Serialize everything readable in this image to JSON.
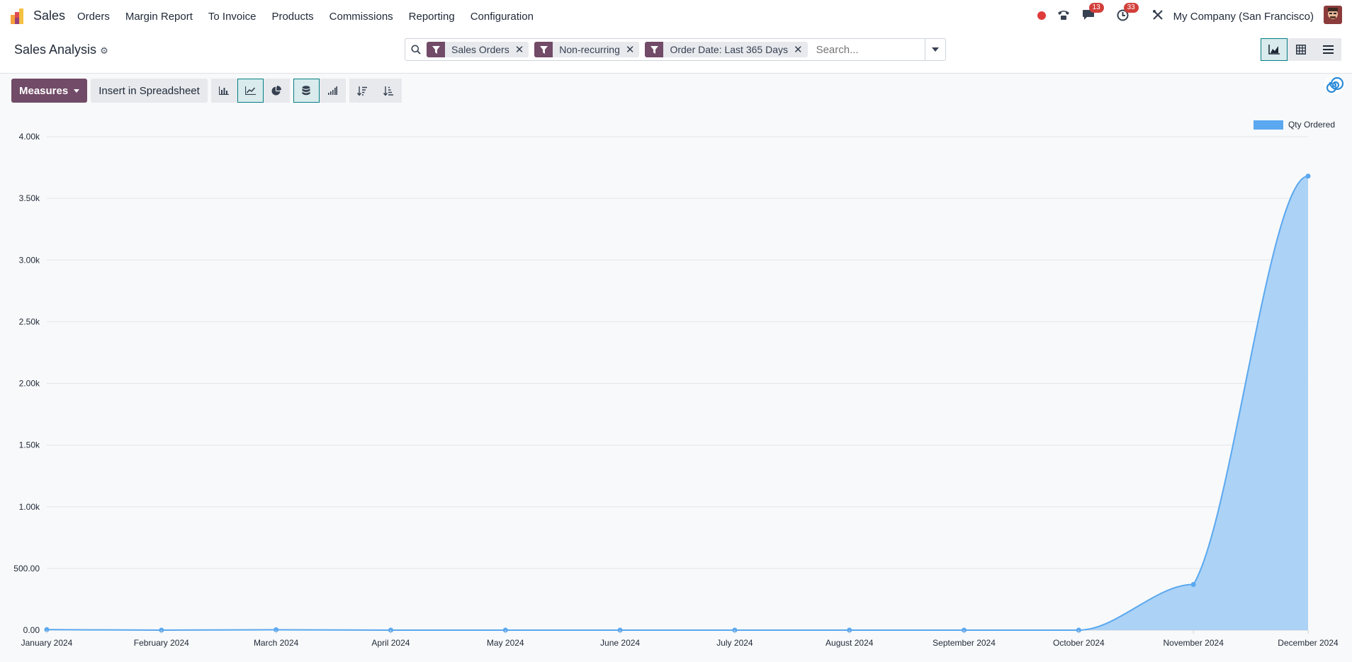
{
  "app": {
    "name": "Sales"
  },
  "menu": [
    "Orders",
    "Margin Report",
    "To Invoice",
    "Products",
    "Commissions",
    "Reporting",
    "Configuration"
  ],
  "systray": {
    "messages_count": "13",
    "activities_count": "33",
    "company": "My Company (San Francisco)"
  },
  "breadcrumb": {
    "title": "Sales Analysis"
  },
  "search": {
    "facets": [
      {
        "label": "Sales Orders",
        "icon": "filter-icon"
      },
      {
        "label": "Non-recurring",
        "icon": "filter-icon"
      },
      {
        "label": "Order Date: Last 365 Days",
        "icon": "filter-icon"
      }
    ],
    "placeholder": "Search..."
  },
  "toolbar": {
    "measures_label": "Measures",
    "insert_label": "Insert in Spreadsheet"
  },
  "views": [
    "graph-view",
    "pivot-view",
    "list-view"
  ],
  "colors": {
    "accent": "#714b67",
    "series": "#5aa8f0",
    "active": "#017e84"
  },
  "chart_data": {
    "type": "area",
    "categories": [
      "January 2024",
      "February 2024",
      "March 2024",
      "April 2024",
      "May 2024",
      "June 2024",
      "July 2024",
      "August 2024",
      "September 2024",
      "October 2024",
      "November 2024",
      "December 2024"
    ],
    "series": [
      {
        "name": "Qty Ordered",
        "values": [
          4,
          0,
          3,
          0,
          0,
          0,
          0,
          0,
          0,
          0,
          370,
          3680
        ]
      }
    ],
    "ylim": [
      0,
      4000
    ],
    "yticks": [
      "0.00",
      "500.00",
      "1.00k",
      "1.50k",
      "2.00k",
      "2.50k",
      "3.00k",
      "3.50k",
      "4.00k"
    ],
    "grid": true,
    "legend": "top-right"
  }
}
